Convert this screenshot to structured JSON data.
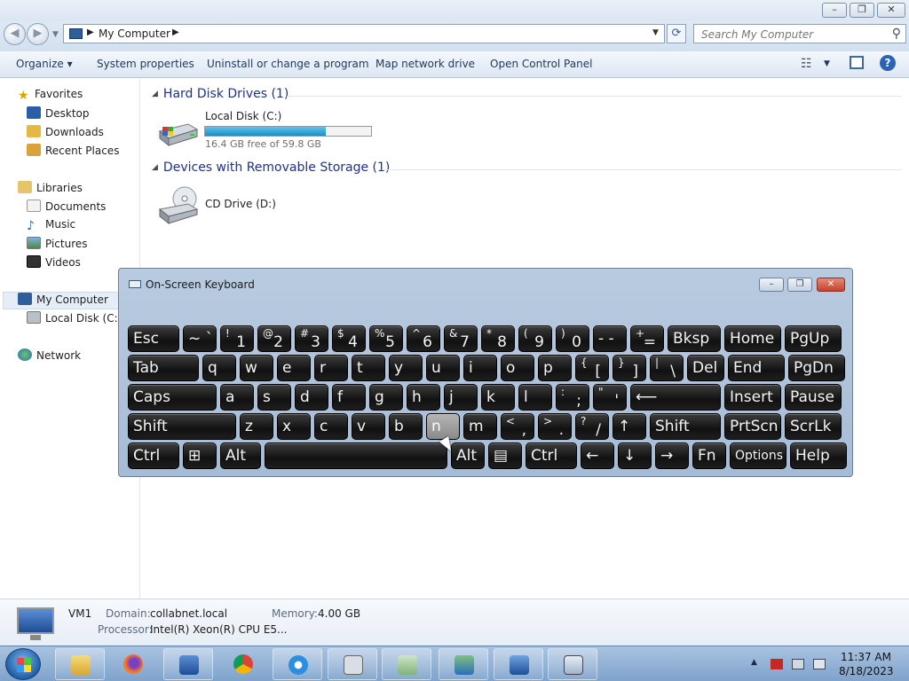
{
  "window": {
    "controls": {
      "minimize": "–",
      "maximize": "❐",
      "close": "✕"
    }
  },
  "address": {
    "path": "My Computer",
    "search_placeholder": "Search My Computer"
  },
  "toolbar": {
    "organize": "Organize ▾",
    "system_properties": "System properties",
    "uninstall": "Uninstall or change a program",
    "map_network": "Map network drive",
    "control_panel": "Open Control Panel",
    "help": "?"
  },
  "nav": {
    "favorites": "Favorites",
    "desktop": "Desktop",
    "downloads": "Downloads",
    "recent_places": "Recent Places",
    "libraries": "Libraries",
    "documents": "Documents",
    "music": "Music",
    "pictures": "Pictures",
    "videos": "Videos",
    "my_computer": "My Computer",
    "local_disk": "Local Disk (C:)",
    "network": "Network"
  },
  "content": {
    "hdd_header": "Hard Disk Drives (1)",
    "removable_header": "Devices with Removable Storage (1)",
    "drive_c": {
      "label": "Local Disk (C:)",
      "free_text": "16.4 GB free of 59.8 GB",
      "used_fraction": 0.726
    },
    "drive_d": {
      "label": "CD Drive (D:)"
    }
  },
  "osk": {
    "title": "On-Screen Keyboard",
    "rows": [
      [
        {
          "main": "Esc"
        },
        {
          "main": "~ `"
        },
        {
          "shift": "!",
          "main": "1"
        },
        {
          "shift": "@",
          "main": "2"
        },
        {
          "shift": "#",
          "main": "3"
        },
        {
          "shift": "$",
          "main": "4"
        },
        {
          "shift": "%",
          "main": "5"
        },
        {
          "shift": "^",
          "main": "6"
        },
        {
          "shift": "&",
          "main": "7"
        },
        {
          "shift": "*",
          "main": "8"
        },
        {
          "shift": "(",
          "main": "9"
        },
        {
          "shift": ")",
          "main": "0"
        },
        {
          "main": "- -"
        },
        {
          "shift": "+",
          "main": "="
        },
        {
          "main": "Bksp"
        },
        {
          "main": "Home"
        },
        {
          "main": "PgUp"
        }
      ],
      [
        {
          "main": "Tab"
        },
        {
          "main": "q"
        },
        {
          "main": "w"
        },
        {
          "main": "e"
        },
        {
          "main": "r"
        },
        {
          "main": "t"
        },
        {
          "main": "y"
        },
        {
          "main": "u"
        },
        {
          "main": "i"
        },
        {
          "main": "o"
        },
        {
          "main": "p"
        },
        {
          "shift": "{",
          "main": "["
        },
        {
          "shift": "}",
          "main": "]"
        },
        {
          "shift": "|",
          "main": "\\"
        },
        {
          "main": "Del"
        },
        {
          "main": "End"
        },
        {
          "main": "PgDn"
        }
      ],
      [
        {
          "main": "Caps"
        },
        {
          "main": "a"
        },
        {
          "main": "s"
        },
        {
          "main": "d"
        },
        {
          "main": "f"
        },
        {
          "main": "g"
        },
        {
          "main": "h"
        },
        {
          "main": "j"
        },
        {
          "main": "k"
        },
        {
          "main": "l"
        },
        {
          "shift": ":",
          "main": ";"
        },
        {
          "shift": "\"",
          "main": "'"
        },
        {
          "main": "⟵"
        },
        {
          "main": "Insert"
        },
        {
          "main": "Pause"
        }
      ],
      [
        {
          "main": "Shift"
        },
        {
          "main": "z"
        },
        {
          "main": "x"
        },
        {
          "main": "c"
        },
        {
          "main": "v"
        },
        {
          "main": "b"
        },
        {
          "main": "n"
        },
        {
          "main": "m"
        },
        {
          "shift": "<",
          "main": ","
        },
        {
          "shift": ">",
          "main": "."
        },
        {
          "shift": "?",
          "main": "/"
        },
        {
          "main": "↑"
        },
        {
          "main": "Shift"
        },
        {
          "main": "PrtScn"
        },
        {
          "main": "ScrLk"
        }
      ],
      [
        {
          "main": "Ctrl"
        },
        {
          "main": "⊞"
        },
        {
          "main": "Alt"
        },
        {
          "main": ""
        },
        {
          "main": "Alt"
        },
        {
          "main": "▤"
        },
        {
          "main": "Ctrl"
        },
        {
          "main": "←"
        },
        {
          "main": "↓"
        },
        {
          "main": "→"
        },
        {
          "main": "Fn"
        },
        {
          "main": "Options"
        },
        {
          "main": "Help"
        }
      ]
    ]
  },
  "details": {
    "name": "VM1",
    "domain_label": "Domain:",
    "domain_value": "collabnet.local",
    "memory_label": "Memory:",
    "memory_value": "4.00 GB",
    "processor_label": "Processor:",
    "processor_value": "Intel(R) Xeon(R) CPU E5..."
  },
  "taskbar": {
    "apps": [
      "file-explorer",
      "firefox",
      "computer-management",
      "chrome",
      "internet-explorer",
      "disk-utility",
      "document-viewer",
      "network-tool",
      "remote-desktop",
      "on-screen-keyboard"
    ],
    "time": "11:37 AM",
    "date": "8/18/2023"
  }
}
